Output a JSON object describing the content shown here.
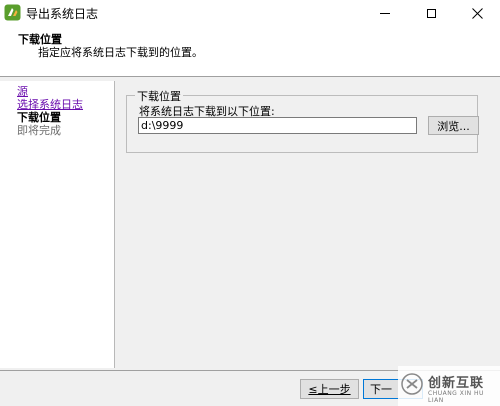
{
  "window": {
    "title": "导出系统日志",
    "icon": "vsphere-app-icon"
  },
  "header": {
    "title": "下载位置",
    "subtitle": "指定应将系统日志下载到的位置。"
  },
  "nav": {
    "items": [
      {
        "label": "源",
        "state": "link"
      },
      {
        "label": "选择系统日志",
        "state": "link"
      },
      {
        "label": "下载位置",
        "state": "current"
      },
      {
        "label": "即将完成",
        "state": "disabled"
      }
    ]
  },
  "download": {
    "group_label": "下载位置",
    "field_label": "将系统日志下载到以下位置:",
    "path_value": "d:\\9999",
    "browse_label": "浏览..."
  },
  "footer": {
    "back_label": "≤上一步",
    "next_label": "下一"
  },
  "watermark": {
    "brand": "创新互联",
    "sub": "CHUANG XIN HU LIAN"
  },
  "colors": {
    "link": "#6a0dad",
    "focus_border": "#0078d7",
    "disabled_text": "#6d6d6d"
  }
}
